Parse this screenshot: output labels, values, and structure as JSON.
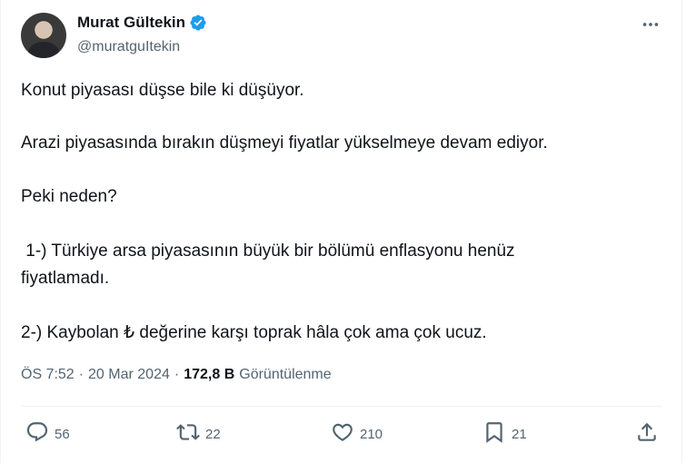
{
  "tweet": {
    "author": {
      "name": "Murat Gültekin",
      "handle": "@muratguItekin",
      "verified": true
    },
    "paragraphs": [
      "Konut piyasası düşse bile ki düşüyor.",
      "Arazi piyasasında bırakın düşmeyi fiyatlar yükselmeye devam ediyor.",
      "Peki neden?",
      " 1-) Türkiye arsa piyasasının büyük bir bölümü enflasyonu henüz",
      "fiyatlamadı.",
      "2-) Kaybolan ₺ değerine karşı toprak hâla çok ama çok ucuz."
    ],
    "meta": {
      "time": "ÖS 7:52",
      "separator": "·",
      "date": "20 Mar 2024",
      "views_count": "172,8 B",
      "views_label": "Görüntülenme"
    },
    "actions": {
      "replies": "56",
      "reposts": "22",
      "likes": "210",
      "bookmarks": "21"
    }
  },
  "icons": {
    "verified": "verified-badge-icon",
    "more": "more-dots-icon",
    "reply": "reply-icon",
    "repost": "repost-icon",
    "like": "heart-icon",
    "bookmark": "bookmark-icon",
    "share": "share-icon"
  },
  "colors": {
    "text": "#0f1419",
    "secondary": "#536471",
    "verified": "#1d9bf0",
    "divider": "#eff3f4"
  }
}
